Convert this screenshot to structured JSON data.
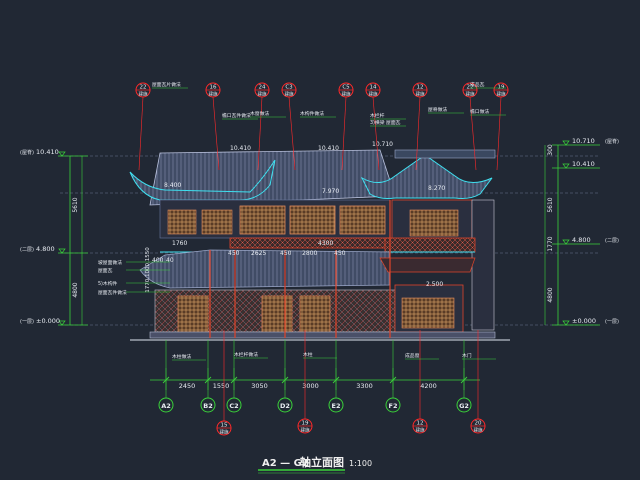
{
  "elevations_left": [
    {
      "label": "(屋脊)",
      "value": "10.410"
    },
    {
      "label": "(二层)",
      "value": "4.800"
    },
    {
      "label": "(一层)",
      "value": "±0.000"
    }
  ],
  "elevations_right": [
    {
      "label": "(屋脊)",
      "value": "10.710"
    },
    {
      "label": "",
      "value": "10.410"
    },
    {
      "label": "(二层)",
      "value": "4.800"
    },
    {
      "label": "(一层)",
      "value": "±0.000"
    }
  ],
  "left_vertical_dims": [
    "5610",
    "4800"
  ],
  "right_vertical_dims": [
    "300",
    "5610",
    "1770",
    "4800"
  ],
  "inner_dims": {
    "top_levels": [
      "10.410",
      "10.410",
      "10.710"
    ],
    "eave_levels": [
      "8.400",
      "7.970",
      "8.270"
    ],
    "mid": [
      "1760",
      "450",
      "2625",
      "450",
      "2800",
      "450"
    ],
    "mid_upper": "4300",
    "side": [
      "400",
      "40"
    ],
    "vertical_left": "1770,1000,1550",
    "lower_right": "2.500"
  },
  "horizontal_dims": [
    "2450",
    "1550",
    "3050",
    "3000",
    "3300",
    "4200"
  ],
  "axes": [
    "A2",
    "B2",
    "C2",
    "D2",
    "E2",
    "F2",
    "G2"
  ],
  "top_callouts": [
    {
      "id": "22",
      "sheet": "建施"
    },
    {
      "id": "16",
      "sheet": "建施"
    },
    {
      "id": "24",
      "sheet": "建施"
    },
    {
      "id": "C3",
      "sheet": "建施"
    },
    {
      "id": "C5",
      "sheet": "建施"
    },
    {
      "id": "14",
      "sheet": "建施"
    },
    {
      "id": "12",
      "sheet": "建施"
    },
    {
      "id": "22",
      "sheet": "建施"
    },
    {
      "id": "19",
      "sheet": "建施"
    }
  ],
  "bottom_callouts": [
    {
      "id": "15",
      "sheet": "建施"
    },
    {
      "id": "19",
      "sheet": "建施"
    },
    {
      "id": "12",
      "sheet": "建施"
    },
    {
      "id": "20",
      "sheet": "建施"
    }
  ],
  "top_notes": [
    "屋面瓦片做法",
    "檐口瓦件做法",
    "木窗做法",
    "木构件做法",
    "木栏杆",
    "3)横梁 屋面瓦",
    "屋脊做法",
    "成品瓦",
    "檐口做法"
  ],
  "left_notes": [
    "坡屋面做法",
    "屋面瓦",
    "5)木构件",
    "屋面瓦件做法"
  ],
  "bottom_notes": [
    "木柱做法",
    "木栏杆做法",
    "木柱",
    "成品窗",
    "木门"
  ],
  "title": {
    "axes": "A2 — G2",
    "name": "轴立面图",
    "scale": "1:100"
  },
  "colors": {
    "background": "#212834",
    "dim": "#3ad13a",
    "callout": "#ff2a2a",
    "roof": "#8e99b8",
    "frame": "#e0442a",
    "window": "#caa06a",
    "axis": "#3ad13a"
  }
}
